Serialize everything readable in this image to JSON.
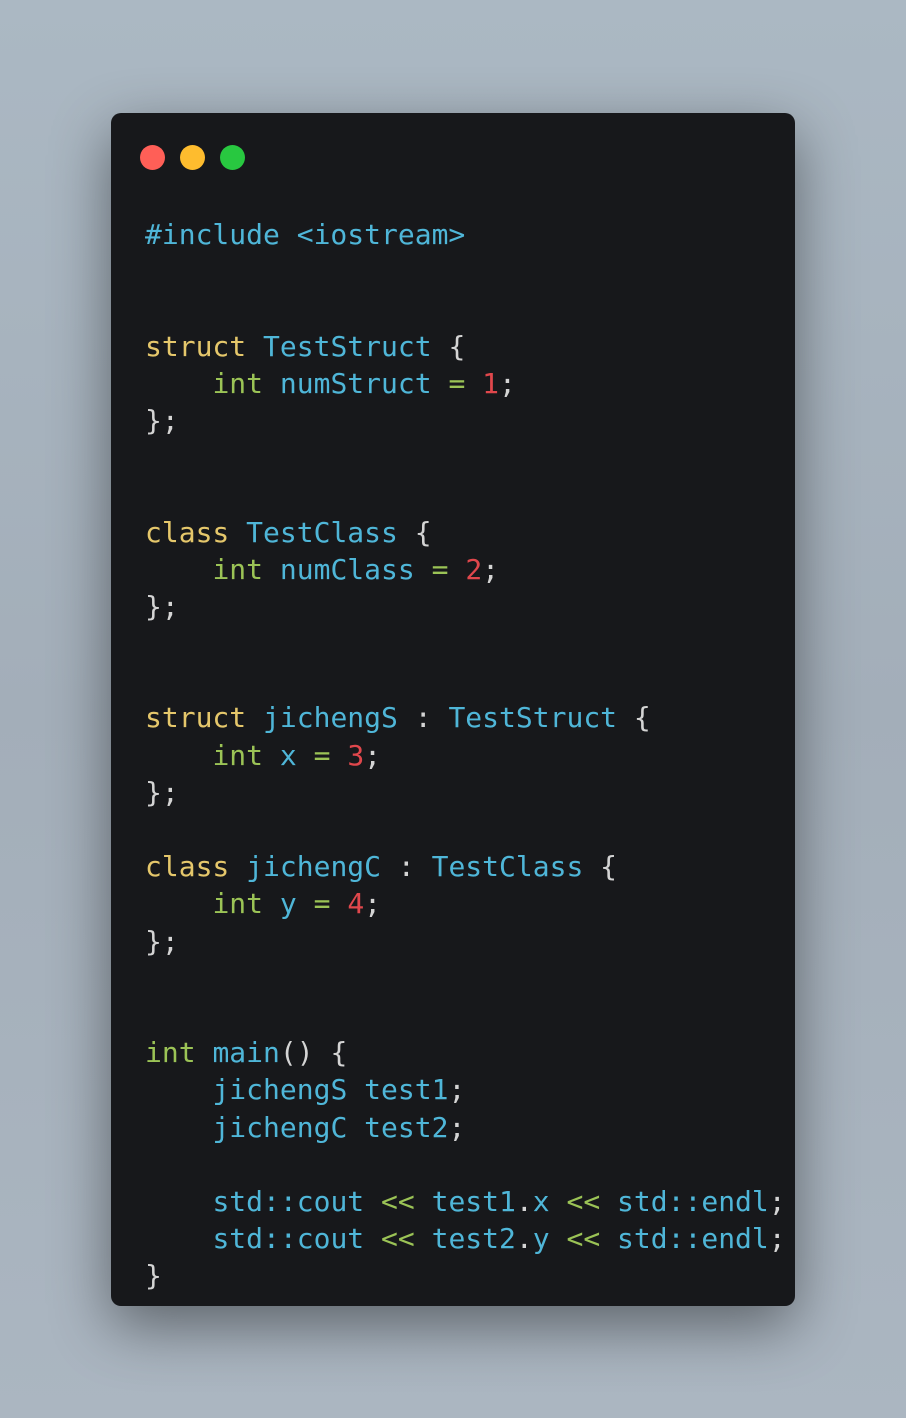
{
  "window": {
    "controls": [
      {
        "name": "close",
        "color": "#ff5f57"
      },
      {
        "name": "minimize",
        "color": "#febc2e"
      },
      {
        "name": "maximize",
        "color": "#28c840"
      }
    ]
  },
  "code": {
    "language": "cpp",
    "lines": [
      [
        [
          "id",
          "#include <iostream>"
        ]
      ],
      [],
      [],
      [
        [
          "kw",
          "struct"
        ],
        [
          "pu",
          " "
        ],
        [
          "id",
          "TestStruct"
        ],
        [
          "pu",
          " {"
        ]
      ],
      [
        [
          "pu",
          "    "
        ],
        [
          "ty",
          "int"
        ],
        [
          "pu",
          " "
        ],
        [
          "id",
          "numStruct"
        ],
        [
          "pu",
          " "
        ],
        [
          "op",
          "="
        ],
        [
          "pu",
          " "
        ],
        [
          "num",
          "1"
        ],
        [
          "pu",
          ";"
        ]
      ],
      [
        [
          "pu",
          "};"
        ]
      ],
      [],
      [],
      [
        [
          "kw",
          "class"
        ],
        [
          "pu",
          " "
        ],
        [
          "id",
          "TestClass"
        ],
        [
          "pu",
          " {"
        ]
      ],
      [
        [
          "pu",
          "    "
        ],
        [
          "ty",
          "int"
        ],
        [
          "pu",
          " "
        ],
        [
          "id",
          "numClass"
        ],
        [
          "pu",
          " "
        ],
        [
          "op",
          "="
        ],
        [
          "pu",
          " "
        ],
        [
          "num",
          "2"
        ],
        [
          "pu",
          ";"
        ]
      ],
      [
        [
          "pu",
          "};"
        ]
      ],
      [],
      [],
      [
        [
          "kw",
          "struct"
        ],
        [
          "pu",
          " "
        ],
        [
          "id",
          "jichengS"
        ],
        [
          "pu",
          " : "
        ],
        [
          "id",
          "TestStruct"
        ],
        [
          "pu",
          " {"
        ]
      ],
      [
        [
          "pu",
          "    "
        ],
        [
          "ty",
          "int"
        ],
        [
          "pu",
          " "
        ],
        [
          "id",
          "x"
        ],
        [
          "pu",
          " "
        ],
        [
          "op",
          "="
        ],
        [
          "pu",
          " "
        ],
        [
          "num",
          "3"
        ],
        [
          "pu",
          ";"
        ]
      ],
      [
        [
          "pu",
          "};"
        ]
      ],
      [],
      [
        [
          "kw",
          "class"
        ],
        [
          "pu",
          " "
        ],
        [
          "id",
          "jichengC"
        ],
        [
          "pu",
          " : "
        ],
        [
          "id",
          "TestClass"
        ],
        [
          "pu",
          " {"
        ]
      ],
      [
        [
          "pu",
          "    "
        ],
        [
          "ty",
          "int"
        ],
        [
          "pu",
          " "
        ],
        [
          "id",
          "y"
        ],
        [
          "pu",
          " "
        ],
        [
          "op",
          "="
        ],
        [
          "pu",
          " "
        ],
        [
          "num",
          "4"
        ],
        [
          "pu",
          ";"
        ]
      ],
      [
        [
          "pu",
          "};"
        ]
      ],
      [],
      [],
      [
        [
          "ty",
          "int"
        ],
        [
          "pu",
          " "
        ],
        [
          "id",
          "main"
        ],
        [
          "pu",
          "() {"
        ]
      ],
      [
        [
          "pu",
          "    "
        ],
        [
          "id",
          "jichengS"
        ],
        [
          "pu",
          " "
        ],
        [
          "id",
          "test1"
        ],
        [
          "pu",
          ";"
        ]
      ],
      [
        [
          "pu",
          "    "
        ],
        [
          "id",
          "jichengC"
        ],
        [
          "pu",
          " "
        ],
        [
          "id",
          "test2"
        ],
        [
          "pu",
          ";"
        ]
      ],
      [],
      [
        [
          "pu",
          "    "
        ],
        [
          "id",
          "std::cout"
        ],
        [
          "pu",
          " "
        ],
        [
          "op",
          "<<"
        ],
        [
          "pu",
          " "
        ],
        [
          "id",
          "test1"
        ],
        [
          "pu",
          "."
        ],
        [
          "id",
          "x"
        ],
        [
          "pu",
          " "
        ],
        [
          "op",
          "<<"
        ],
        [
          "pu",
          " "
        ],
        [
          "id",
          "std::endl"
        ],
        [
          "pu",
          ";"
        ]
      ],
      [
        [
          "pu",
          "    "
        ],
        [
          "id",
          "std::cout"
        ],
        [
          "pu",
          " "
        ],
        [
          "op",
          "<<"
        ],
        [
          "pu",
          " "
        ],
        [
          "id",
          "test2"
        ],
        [
          "pu",
          "."
        ],
        [
          "id",
          "y"
        ],
        [
          "pu",
          " "
        ],
        [
          "op",
          "<<"
        ],
        [
          "pu",
          " "
        ],
        [
          "id",
          "std::endl"
        ],
        [
          "pu",
          ";"
        ]
      ],
      [
        [
          "pu",
          "}"
        ]
      ]
    ],
    "colors": {
      "keyword": "#e5c76b",
      "identifier": "#4fb6d8",
      "type": "#9bc356",
      "number": "#e0474c",
      "operator": "#9bc356",
      "punctuation": "#d4d4d4",
      "background": "#17181b"
    }
  }
}
